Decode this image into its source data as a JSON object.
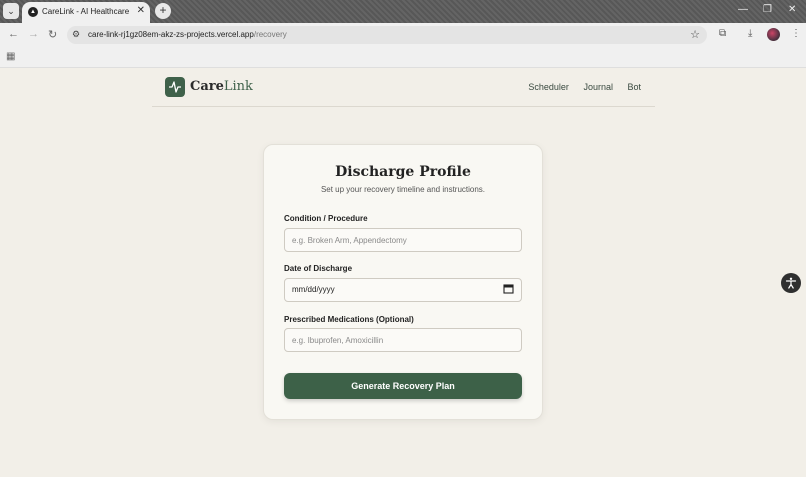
{
  "browser": {
    "tab_title": "CareLink - AI Healthcare",
    "url_host": "care-link-rj1gz08em-akz-zs-projects.vercel.app",
    "url_path": "/recovery",
    "icons": [
      "tab-search-icon",
      "favicon-icon",
      "close-icon",
      "plus-icon",
      "minimize-icon",
      "restore-icon",
      "close-window-icon",
      "back-icon",
      "forward-icon",
      "reload-icon",
      "site-info-icon",
      "star-icon",
      "extensions-icon",
      "download-icon",
      "avatar",
      "menu-icon",
      "apps-icon"
    ]
  },
  "header": {
    "brand_part1": "Care",
    "brand_part2": "Link",
    "nav": [
      "Scheduler",
      "Journal",
      "Bot"
    ]
  },
  "form": {
    "title": "Discharge Profile",
    "subtitle": "Set up your recovery timeline and instructions.",
    "condition_label": "Condition / Procedure",
    "condition_placeholder": "e.g. Broken Arm, Appendectomy",
    "date_label": "Date of Discharge",
    "date_placeholder": "mm/dd/yyyy",
    "medications_label": "Prescribed Medications (Optional)",
    "medications_placeholder": "e.g. Ibuprofen, Amoxicillin",
    "submit_label": "Generate Recovery Plan"
  },
  "colors": {
    "brand_green": "#3f614a",
    "page_bg": "#f2efe8",
    "card_bg": "#f9f8f3"
  }
}
